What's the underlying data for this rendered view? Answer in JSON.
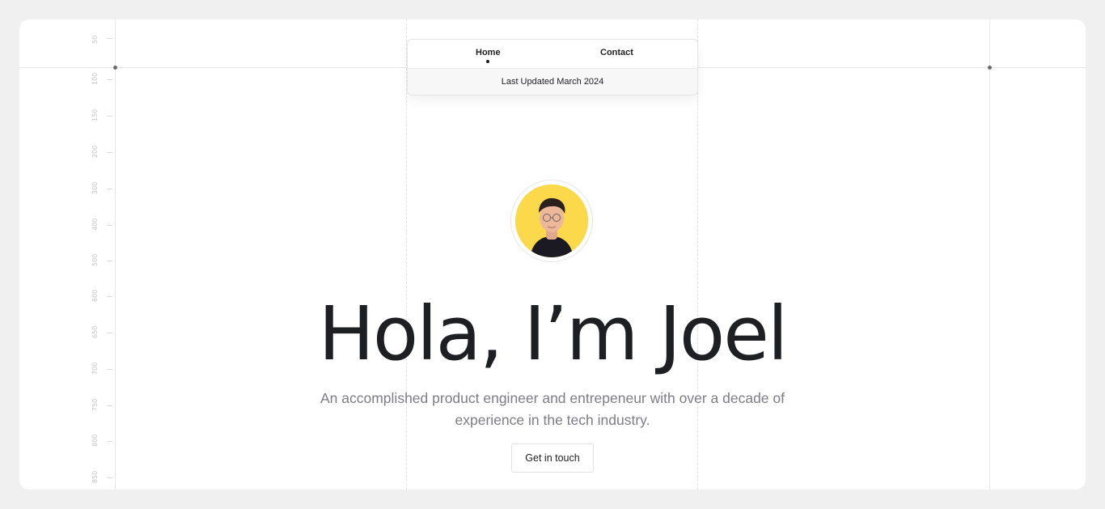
{
  "nav": {
    "links": [
      {
        "label": "Home",
        "active": true
      },
      {
        "label": "Contact",
        "active": false
      }
    ],
    "updated": "Last Updated March 2024"
  },
  "ruler": {
    "ticks": [
      "50",
      "100",
      "150",
      "200",
      "300",
      "400",
      "500",
      "600",
      "650",
      "700",
      "750",
      "800",
      "850"
    ]
  },
  "hero": {
    "title": "Hola, I’m Joel",
    "subtitle": "An accomplished product engineer and entrepeneur with over a decade of experience in the tech industry.",
    "cta_label": "Get in touch",
    "avatar_icon": "portrait-photo"
  },
  "colors": {
    "page_background": "#f0f0f1",
    "card_background": "#ffffff",
    "avatar_background": "#fbd94a",
    "text_primary": "#1e1f22",
    "text_muted": "#7d7d85"
  }
}
